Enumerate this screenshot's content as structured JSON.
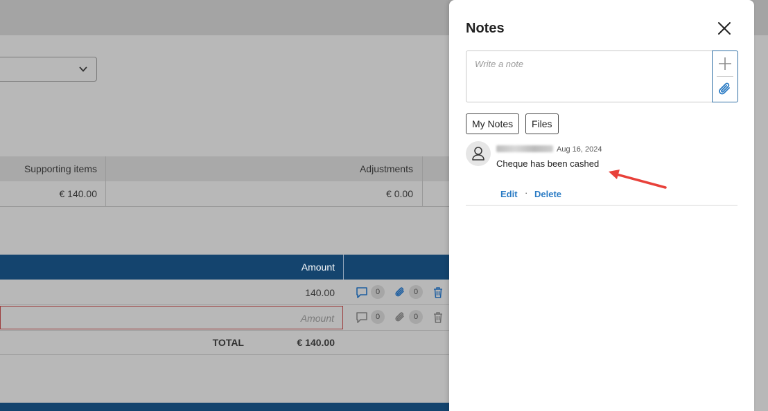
{
  "background": {
    "summary_table": {
      "headers": [
        "Supporting items",
        "Adjustments"
      ],
      "values": [
        "€ 140.00",
        "€ 0.00"
      ]
    },
    "line_table": {
      "amount_header": "Amount",
      "rows": [
        {
          "amount": "140.00",
          "comments": "0",
          "attachments": "0"
        },
        {
          "amount_placeholder": "Amount",
          "comments": "0",
          "attachments": "0"
        }
      ],
      "total_label": "TOTAL",
      "total_value": "€ 140.00"
    },
    "colors": {
      "header_blue": "#14446e",
      "overlay_gray": "#b8b8b8"
    }
  },
  "notes_panel": {
    "title": "Notes",
    "input_placeholder": "Write a note",
    "tabs": [
      "My Notes",
      "Files"
    ],
    "notes": [
      {
        "date": "Aug 16, 2024",
        "text": "Cheque has been cashed",
        "edit_label": "Edit",
        "separator": "·",
        "delete_label": "Delete"
      }
    ],
    "colors": {
      "link_blue": "#2a7bc4",
      "accent_blue": "#2d6da3",
      "annotation_red": "#e8413a"
    }
  }
}
